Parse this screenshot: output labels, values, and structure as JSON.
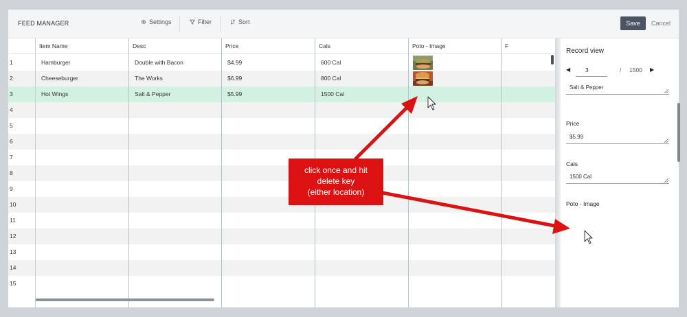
{
  "app": {
    "title": "FEED MANAGER",
    "settings_label": "Settings",
    "filter_label": "Filter",
    "sort_label": "Sort",
    "save_label": "Save",
    "cancel_label": "Cancel"
  },
  "grid": {
    "columns": [
      "Item Name",
      "Desc",
      "Price",
      "Cals",
      "Poto - Image",
      "F"
    ],
    "rows": [
      {
        "num": "1",
        "item": "Hamburger",
        "desc": "Double with Bacon",
        "price": "$4.99",
        "cals": "600 Cal",
        "image": "hamburger-thumbnail"
      },
      {
        "num": "2",
        "item": "Cheeseburger",
        "desc": "The Works",
        "price": "$6.99",
        "cals": "800 Cal",
        "image": "cheeseburger-thumbnail"
      },
      {
        "num": "3",
        "item": "Hot Wings",
        "desc": "Salt & Pepper",
        "price": "$5.99",
        "cals": "1500 Cal",
        "image": ""
      },
      {
        "num": "4"
      },
      {
        "num": "5"
      },
      {
        "num": "6"
      },
      {
        "num": "7"
      },
      {
        "num": "8"
      },
      {
        "num": "9"
      },
      {
        "num": "10"
      },
      {
        "num": "11"
      },
      {
        "num": "12"
      },
      {
        "num": "13"
      },
      {
        "num": "14"
      },
      {
        "num": "15"
      }
    ],
    "selected_row": 3
  },
  "record_view": {
    "title": "Record view",
    "current": "3",
    "separator": "/",
    "total": "1500",
    "desc_value": "Salt & Pepper",
    "price_label": "Price",
    "price_value": "$5.99",
    "cals_label": "Cals",
    "cals_value": "1500 Cal",
    "image_label": "Poto - Image"
  },
  "annotation": {
    "line1": "click once and hit",
    "line2": "delete key",
    "line3": "(either location)",
    "color": "#dc1212"
  },
  "colors": {
    "selected_row": "#d2f1e2",
    "save_button": "#4a5561",
    "alt_row": "#f2f2f2"
  }
}
